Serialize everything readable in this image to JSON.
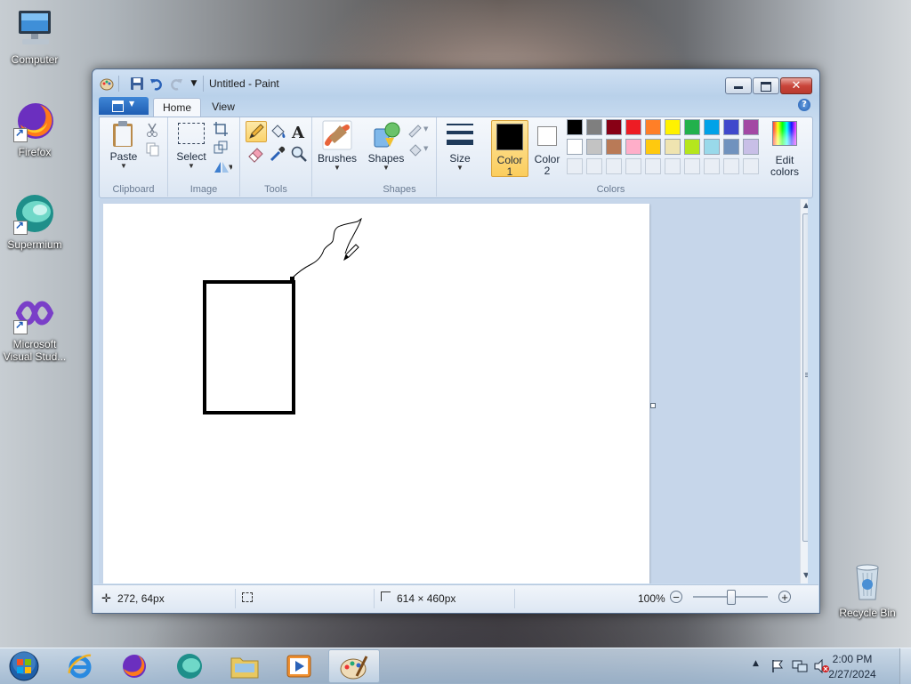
{
  "desktop": {
    "icons": [
      {
        "label": "Computer",
        "icon": "computer-icon"
      },
      {
        "label": "Firefox",
        "icon": "firefox-icon"
      },
      {
        "label": "Supermium",
        "icon": "supermium-icon"
      },
      {
        "label": "Microsoft Visual Stud...",
        "icon": "visual-studio-icon"
      },
      {
        "label": "Recycle Bin",
        "icon": "recycle-bin-icon"
      }
    ]
  },
  "window": {
    "title": "Untitled - Paint",
    "tabs": [
      "Home",
      "View"
    ],
    "ribbon": {
      "clipboard": {
        "label": "Clipboard",
        "paste": "Paste"
      },
      "image": {
        "label": "Image",
        "select": "Select"
      },
      "tools": {
        "label": "Tools"
      },
      "brushes": {
        "label": "Brushes"
      },
      "shapes": {
        "label": "Shapes",
        "button": "Shapes"
      },
      "size": {
        "label": "Size"
      },
      "colors": {
        "label": "Colors",
        "color1_line1": "Color",
        "color1_line2": "1",
        "color2_line1": "Color",
        "color2_line2": "2",
        "edit_line1": "Edit",
        "edit_line2": "colors",
        "color1_value": "#000000",
        "color2_value": "#ffffff",
        "palette_row1": [
          "#000000",
          "#7f7f7f",
          "#880015",
          "#ed1c24",
          "#ff7f27",
          "#fff200",
          "#22b14c",
          "#00a2e8",
          "#3f48cc",
          "#a349a4"
        ],
        "palette_row2": [
          "#ffffff",
          "#c3c3c3",
          "#b97a57",
          "#ffaec9",
          "#ffc90e",
          "#efe4b0",
          "#b5e61d",
          "#99d9ea",
          "#7092be",
          "#c8bfe7"
        ]
      }
    },
    "status": {
      "cursor_pos": "272, 64px",
      "canvas_size": "614 × 460px",
      "zoom": "100%"
    }
  },
  "taskbar": {
    "apps": [
      "start-orb",
      "internet-explorer-icon",
      "firefox-icon",
      "supermium-icon",
      "file-explorer-icon",
      "media-player-icon",
      "paint-icon"
    ],
    "time": "2:00 PM",
    "date": "2/27/2024"
  }
}
